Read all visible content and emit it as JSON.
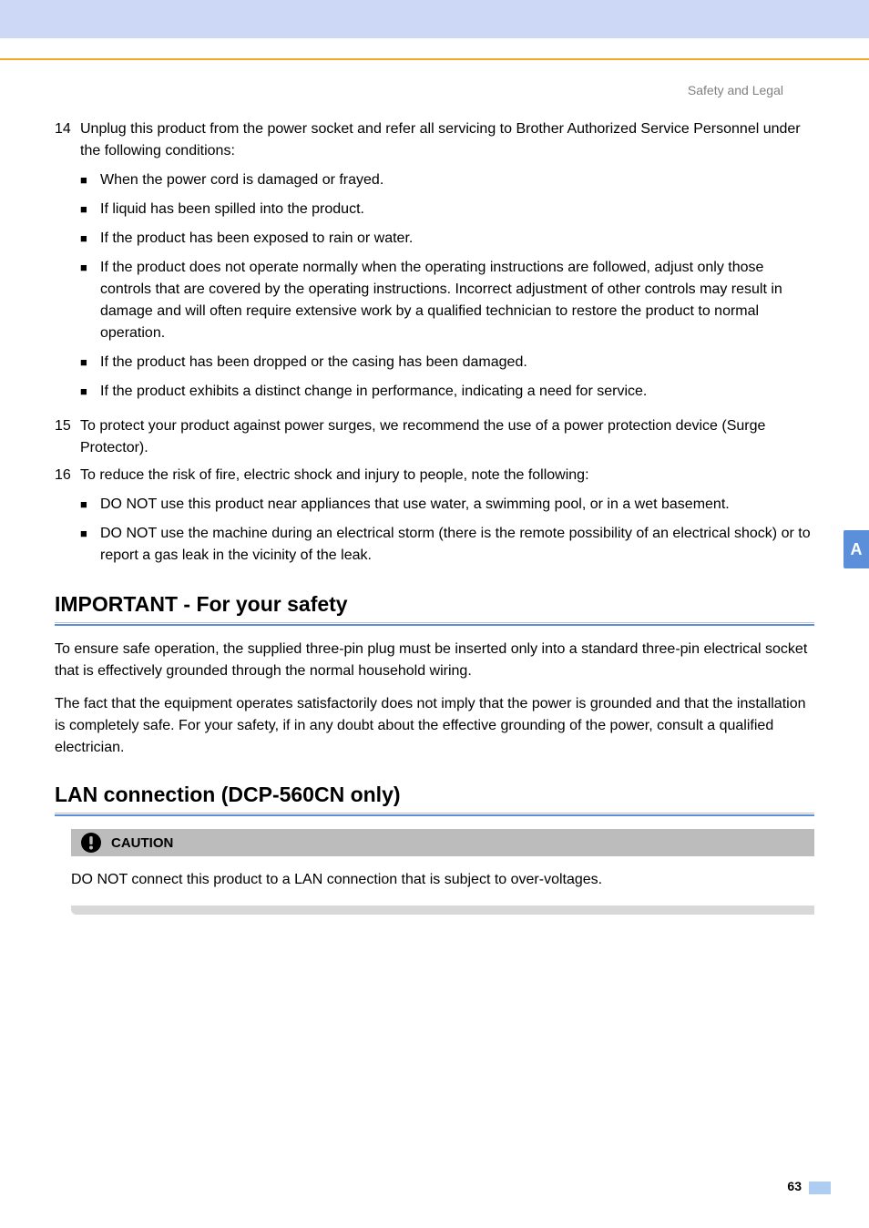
{
  "header": {
    "section_title": "Safety and Legal"
  },
  "side_tab": {
    "letter": "A"
  },
  "list14": {
    "num": "14",
    "intro": "Unplug this product from the power socket and refer all servicing to Brother Authorized Service Personnel under the following conditions:",
    "bullets": [
      "When the power cord is damaged or frayed.",
      "If liquid has been spilled into the product.",
      "If the product has been exposed to rain or water.",
      "If the product does not operate normally when the operating instructions are followed, adjust only those controls that are covered by the operating instructions. Incorrect adjustment of other controls may result in damage and will often require extensive work by a qualified technician to restore the product to normal operation.",
      "If the product has been dropped or the casing has been damaged.",
      "If the product exhibits a distinct change in performance, indicating a need for service."
    ]
  },
  "list15": {
    "num": "15",
    "text": "To protect your product against power surges, we recommend the use of a power protection device (Surge Protector)."
  },
  "list16": {
    "num": "16",
    "intro": "To reduce the risk of fire, electric shock and injury to people, note the following:",
    "bullets": [
      "DO NOT use this product near appliances that use water, a swimming pool, or in a wet basement.",
      "DO NOT use the machine during an electrical storm (there is the remote possibility of an electrical shock) or to report a gas leak in the vicinity of the leak."
    ]
  },
  "important": {
    "heading": "IMPORTANT - For your safety",
    "p1": "To ensure safe operation, the supplied three-pin plug must be inserted only into a standard three-pin electrical socket that is effectively grounded through the normal household wiring.",
    "p2": "The fact that the equipment operates satisfactorily does not imply that the power is grounded and that the installation is completely safe. For your safety, if in any doubt about the effective grounding of the power, consult a qualified electrician."
  },
  "lan": {
    "heading": "LAN connection (DCP-560CN only)",
    "caution_label": "CAUTION",
    "caution_text": "DO NOT connect this product to a LAN connection that is subject to over-voltages."
  },
  "footer": {
    "page": "63"
  }
}
